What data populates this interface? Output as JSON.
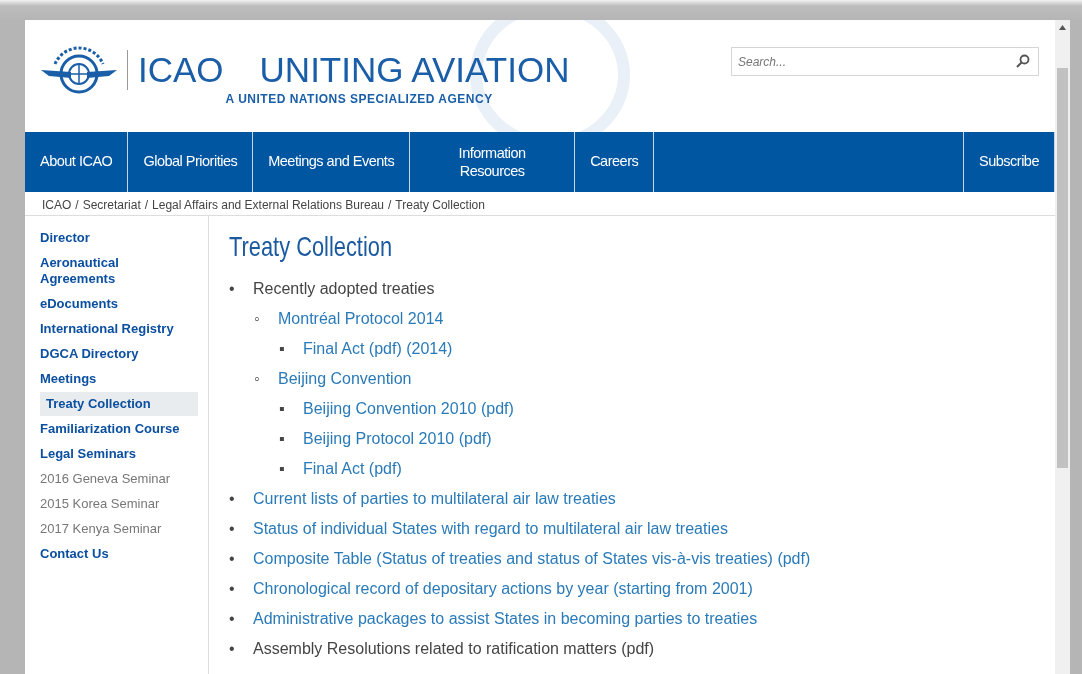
{
  "header": {
    "org": "ICAO",
    "tagline": "UNITING AVIATION",
    "subtitle": "A UNITED NATIONS SPECIALIZED AGENCY",
    "search": {
      "placeholder": "Search..."
    }
  },
  "nav": [
    {
      "label": "About ICAO"
    },
    {
      "label": "Global Priorities"
    },
    {
      "label": "Meetings and Events"
    },
    {
      "label": "Information Resources"
    },
    {
      "label": "Careers"
    },
    {
      "label": "Subscribe"
    }
  ],
  "breadcrumb": [
    {
      "label": "ICAO"
    },
    {
      "separator": "/",
      "label": "Secretariat"
    },
    {
      "separator": "/",
      "label": "Legal Affairs and External Relations Bureau"
    },
    {
      "separator": "/",
      "label": "Treaty Collection"
    }
  ],
  "sidebar": {
    "items": [
      {
        "label": "Director",
        "kind": "section",
        "selected": false
      },
      {
        "label": "Aeronautical Agreements",
        "kind": "section",
        "selected": false
      },
      {
        "label": "eDocuments",
        "kind": "section",
        "selected": false
      },
      {
        "label": "International Registry",
        "kind": "section",
        "selected": false
      },
      {
        "label": "DGCA Directory",
        "kind": "section",
        "selected": false
      },
      {
        "label": "Meetings",
        "kind": "section",
        "selected": false
      },
      {
        "label": "Treaty Collection",
        "kind": "section",
        "selected": true
      },
      {
        "label": "Familiarization Course",
        "kind": "section",
        "selected": false
      },
      {
        "label": "Legal Seminars",
        "kind": "section",
        "selected": false
      },
      {
        "label": "2016 Geneva Seminar",
        "kind": "sub",
        "selected": false
      },
      {
        "label": "2015 Korea Seminar",
        "kind": "sub",
        "selected": false
      },
      {
        "label": "2017 Kenya Seminar",
        "kind": "sub",
        "selected": false
      },
      {
        "label": "Contact Us",
        "kind": "section",
        "selected": false
      }
    ]
  },
  "page": {
    "title": "Treaty Collection",
    "items": [
      {
        "marker": "•",
        "text": "Recently adopted treaties",
        "kind": "text",
        "children": [
          {
            "marker": "◦",
            "text": "Montréal Protocol 2014",
            "kind": "link",
            "children": [
              {
                "marker": "▪",
                "text": "Final Act (pdf) (2014)",
                "kind": "link"
              }
            ]
          },
          {
            "marker": "◦",
            "text": "Beijing Convention",
            "kind": "link",
            "children": [
              {
                "marker": "▪",
                "text": "Beijing Convention 2010 (pdf)",
                "kind": "link"
              },
              {
                "marker": "▪",
                "text": "Beijing Protocol 2010 (pdf)",
                "kind": "link"
              },
              {
                "marker": "▪",
                "text": "Final Act (pdf)",
                "kind": "link"
              }
            ]
          }
        ]
      },
      {
        "marker": "•",
        "text": "Current lists of parties to multilateral air law treaties",
        "kind": "link"
      },
      {
        "marker": "•",
        "text": "Status of individual States with regard to multilateral air law treaties",
        "kind": "link"
      },
      {
        "marker": "•",
        "text": "Composite Table (Status of treaties and status of States vis-à-vis treaties) (pdf)",
        "kind": "link"
      },
      {
        "marker": "•",
        "text": "Chronological record of depositary actions by year (starting from 2001)",
        "kind": "link"
      },
      {
        "marker": "•",
        "text": "Administrative packages to assist States in becoming parties to treaties",
        "kind": "link"
      },
      {
        "marker": "•",
        "text": "Assembly Resolutions related to ratification matters (pdf)",
        "kind": "text"
      }
    ]
  }
}
